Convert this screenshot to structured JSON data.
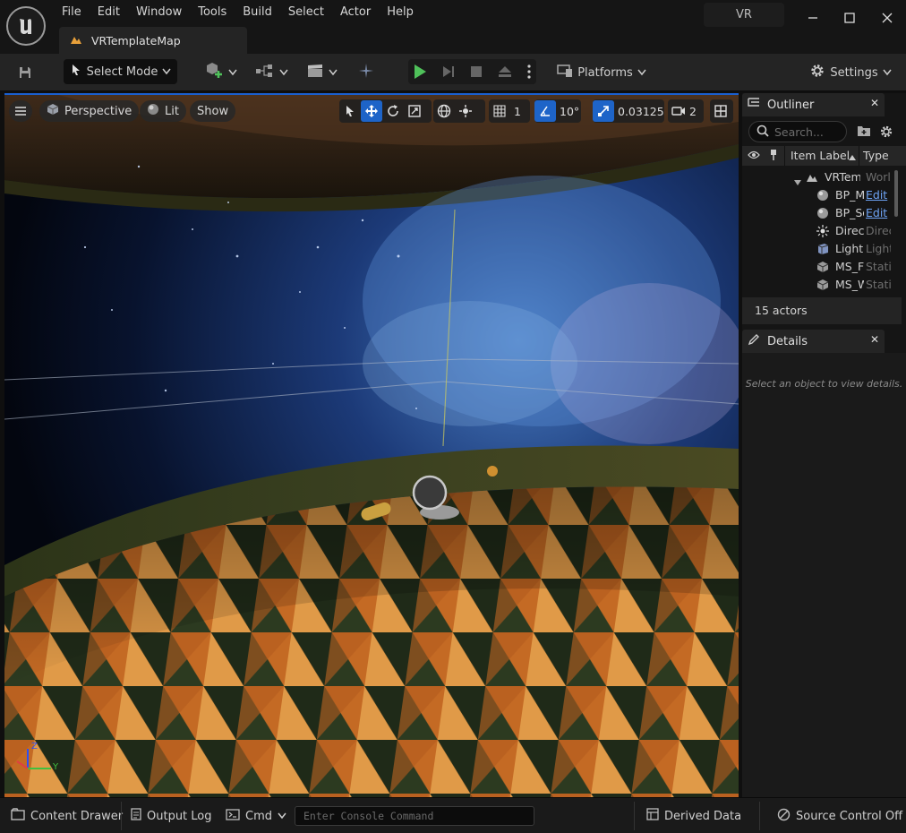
{
  "menu": [
    "File",
    "Edit",
    "Window",
    "Tools",
    "Build",
    "Select",
    "Actor",
    "Help"
  ],
  "project_name": "VR",
  "document_tab": {
    "label": "VRTemplateMap"
  },
  "toolbar": {
    "select_mode": "Select Mode",
    "platforms": "Platforms",
    "settings": "Settings"
  },
  "viewport": {
    "perspective": "Perspective",
    "lit": "Lit",
    "show": "Show",
    "grid_size": "1",
    "rotation_snap": "10°",
    "scale_snap": "0.03125",
    "camera_speed": "2",
    "axis_x": "",
    "axis_y": "Y",
    "axis_z": "Z"
  },
  "outliner": {
    "title": "Outliner",
    "search_placeholder": "Search...",
    "col_label": "Item Label",
    "col_type": "Type",
    "rows": [
      {
        "label": "VRTemplateMap",
        "type": "World",
        "type_link": false
      },
      {
        "label": "BP_MotionControllerPawn",
        "type": "Edit",
        "type_link": true
      },
      {
        "label": "BP_SomeActor",
        "type": "Edit",
        "type_link": true
      },
      {
        "label": "DirectionalLight",
        "type": "DirectionalLight",
        "type_link": false
      },
      {
        "label": "Lightmass",
        "type": "LightmassImportanceVolume",
        "type_link": false
      },
      {
        "label": "MS_Floor",
        "type": "StaticMeshActor",
        "type_link": false
      },
      {
        "label": "MS_Wall",
        "type": "StaticMeshActor",
        "type_link": false
      }
    ],
    "actor_count": "15 actors"
  },
  "details": {
    "title": "Details",
    "empty_hint": "Select an object to view details."
  },
  "statusbar": {
    "content_drawer": "Content Drawer",
    "output_log": "Output Log",
    "cmd": "Cmd",
    "console_placeholder": "Enter Console Command",
    "derived_data": "Derived Data",
    "source_control": "Source Control Off"
  },
  "colors": {
    "accent": "#1e64c8",
    "play": "#4fc15a",
    "link": "#6ea4f6",
    "panel": "#151515"
  }
}
